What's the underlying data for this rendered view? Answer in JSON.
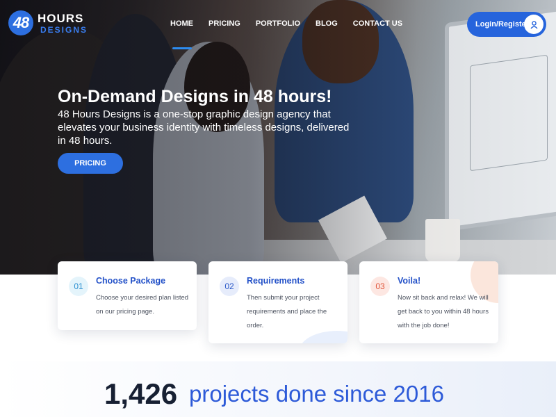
{
  "header": {
    "logo": {
      "number": "48",
      "word1": "HOURS",
      "word2": "DESIGNS"
    },
    "nav": [
      {
        "label": "HOME"
      },
      {
        "label": "PRICING"
      },
      {
        "label": "PORTFOLIO"
      },
      {
        "label": "BLOG"
      },
      {
        "label": "CONTACT US"
      }
    ],
    "login_label": "Login/Register"
  },
  "hero": {
    "title": "On-Demand Designs in 48 hours!",
    "subtitle": "48 Hours Designs is a one-stop graphic design agency that elevates your business identity with timeless designs, delivered in 48 hours.",
    "cta_label": "PRICING"
  },
  "steps": [
    {
      "number": "01",
      "title": "Choose Package",
      "text": "Choose your desired plan listed on our pricing page."
    },
    {
      "number": "02",
      "title": "Requirements",
      "text": "Then submit your project requirements and place the order."
    },
    {
      "number": "03",
      "title": "Voila!",
      "text": "Now sit back and relax! We will get back to you within 48 hours with the job done!"
    }
  ],
  "stats": {
    "count": "1,426",
    "text": "projects done since 2016"
  },
  "colors": {
    "accent": "#2664dc",
    "step1": "#2a8fd0",
    "step2": "#2d5ac8",
    "step3": "#e0553a"
  }
}
